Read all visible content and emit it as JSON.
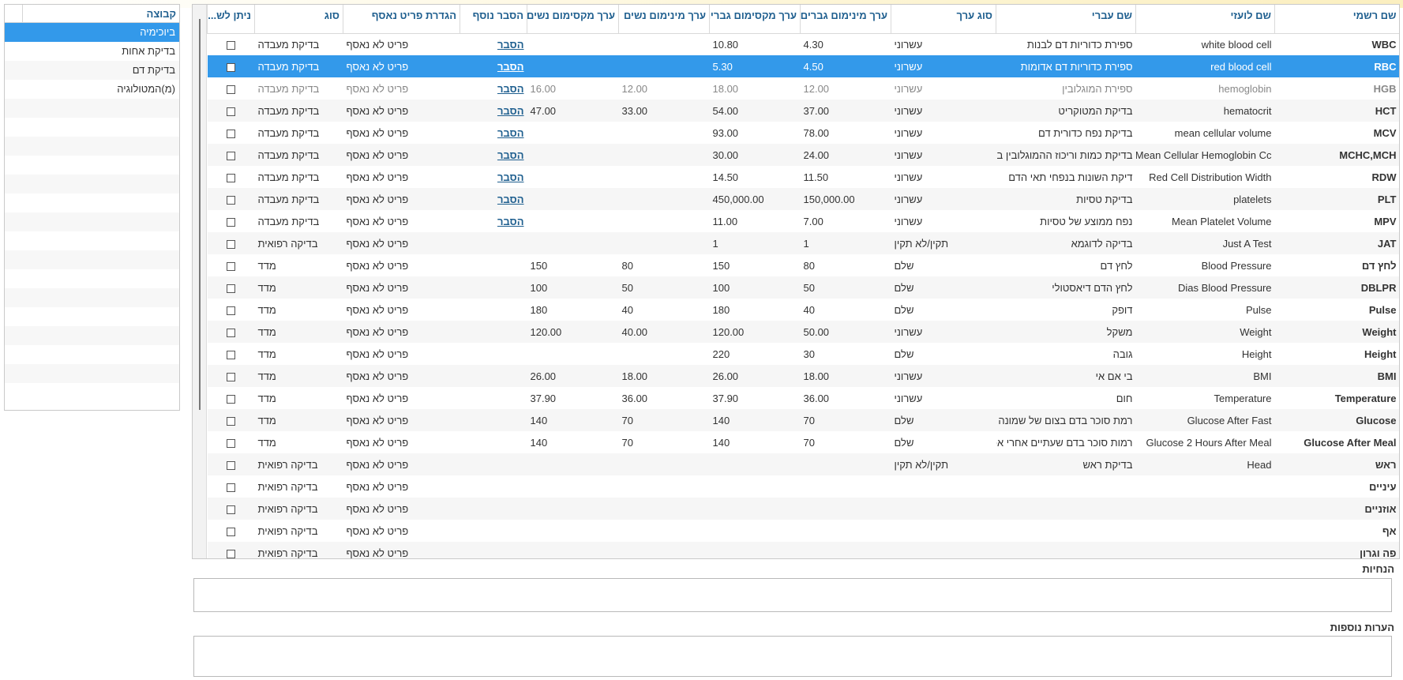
{
  "group_panel": {
    "header": "קבוצה",
    "items": [
      "ביוכימיה",
      "בדיקת אחות",
      "בדיקת דם",
      "(מ)המטולוגיה"
    ],
    "selected_index": 0
  },
  "grid": {
    "columns": [
      "שם רשמי",
      "שם לועזי",
      "שם עברי",
      "סוג ערך",
      "ערך מינימום גברים",
      "ערך מקסימום גברים",
      "ערך מינימום נשים",
      "ערך מקסימום נשים",
      "הסבר נוסף",
      "הגדרת פריט נאסף",
      "סוג",
      "ניתן לש..."
    ],
    "selected_row": 1,
    "rows": [
      {
        "code": "WBC",
        "foreign": "white blood cell",
        "hebrew": "ספירת כדוריות דם לבנות",
        "vtype": "עשרוני",
        "min_m": "4.30",
        "max_m": "10.80",
        "min_f": "",
        "max_f": "",
        "explain": "הסבר",
        "collect": "פריט לא נאסף",
        "kind": "בדיקת מעבדה"
      },
      {
        "code": "RBC",
        "foreign": "red blood cell",
        "hebrew": "ספירת כדוריות דם אדומות",
        "vtype": "עשרוני",
        "min_m": "4.50",
        "max_m": "5.30",
        "min_f": "",
        "max_f": "",
        "explain": "הסבר",
        "collect": "פריט לא נאסף",
        "kind": "בדיקת מעבדה"
      },
      {
        "code": "HGB",
        "foreign": "hemoglobin",
        "hebrew": "ספירת המוגלובין",
        "vtype": "עשרוני",
        "min_m": "12.00",
        "max_m": "18.00",
        "min_f": "12.00",
        "max_f": "16.00",
        "explain": "הסבר",
        "collect": "פריט לא נאסף",
        "kind": "בדיקת מעבדה"
      },
      {
        "code": "HCT",
        "foreign": "hematocrit",
        "hebrew": "בדיקת המטוקריט",
        "vtype": "עשרוני",
        "min_m": "37.00",
        "max_m": "54.00",
        "min_f": "33.00",
        "max_f": "47.00",
        "explain": "הסבר",
        "collect": "פריט לא נאסף",
        "kind": "בדיקת מעבדה"
      },
      {
        "code": "MCV",
        "foreign": "mean cellular volume",
        "hebrew": "בדיקת נפח כדורית דם",
        "vtype": "עשרוני",
        "min_m": "78.00",
        "max_m": "93.00",
        "min_f": "",
        "max_f": "",
        "explain": "הסבר",
        "collect": "פריט לא נאסף",
        "kind": "בדיקת מעבדה"
      },
      {
        "code": "MCHC,MCH",
        "foreign": "Mean Cellular Hemoglobin Cc",
        "hebrew": "בדיקת כמות וריכוז ההמוגלובין בכ:",
        "vtype": "עשרוני",
        "min_m": "24.00",
        "max_m": "30.00",
        "min_f": "",
        "max_f": "",
        "explain": "הסבר",
        "collect": "פריט לא נאסף",
        "kind": "בדיקת מעבדה"
      },
      {
        "code": "RDW",
        "foreign": "Red Cell Distribution Width",
        "hebrew": "דיקת השונות בנפחי תאי הדם",
        "vtype": "עשרוני",
        "min_m": "11.50",
        "max_m": "14.50",
        "min_f": "",
        "max_f": "",
        "explain": "הסבר",
        "collect": "פריט לא נאסף",
        "kind": "בדיקת מעבדה"
      },
      {
        "code": "PLT",
        "foreign": "platelets",
        "hebrew": "בדיקת טסיות",
        "vtype": "עשרוני",
        "min_m": "150,000.00",
        "max_m": "450,000.00",
        "min_f": "",
        "max_f": "",
        "explain": "הסבר",
        "collect": "פריט לא נאסף",
        "kind": "בדיקת מעבדה"
      },
      {
        "code": "MPV",
        "foreign": "Mean Platelet Volume",
        "hebrew": "נפח ממוצע של טסיות",
        "vtype": "עשרוני",
        "min_m": "7.00",
        "max_m": "11.00",
        "min_f": "",
        "max_f": "",
        "explain": "הסבר",
        "collect": "פריט לא נאסף",
        "kind": "בדיקת מעבדה"
      },
      {
        "code": "JAT",
        "foreign": "Just A Test",
        "hebrew": "בדיקה לדוגמא",
        "vtype": "תקין/לא תקין",
        "min_m": "1",
        "max_m": "1",
        "min_f": "",
        "max_f": "",
        "explain": "",
        "collect": "פריט לא נאסף",
        "kind": "בדיקה רפואית"
      },
      {
        "code": "לחץ דם",
        "foreign": "Blood Pressure",
        "hebrew": "לחץ דם",
        "vtype": "שלם",
        "min_m": "80",
        "max_m": "150",
        "min_f": "80",
        "max_f": "150",
        "explain": "",
        "collect": "פריט לא נאסף",
        "kind": "מדד"
      },
      {
        "code": "DBLPR",
        "foreign": "Dias Blood Pressure",
        "hebrew": "לחץ הדם דיאסטולי",
        "vtype": "שלם",
        "min_m": "50",
        "max_m": "100",
        "min_f": "50",
        "max_f": "100",
        "explain": "",
        "collect": "פריט לא נאסף",
        "kind": "מדד"
      },
      {
        "code": "Pulse",
        "foreign": "Pulse",
        "hebrew": "דופק",
        "vtype": "שלם",
        "min_m": "40",
        "max_m": "180",
        "min_f": "40",
        "max_f": "180",
        "explain": "",
        "collect": "פריט לא נאסף",
        "kind": "מדד"
      },
      {
        "code": "Weight",
        "foreign": "Weight",
        "hebrew": "משקל",
        "vtype": "עשרוני",
        "min_m": "50.00",
        "max_m": "120.00",
        "min_f": "40.00",
        "max_f": "120.00",
        "explain": "",
        "collect": "פריט לא נאסף",
        "kind": "מדד"
      },
      {
        "code": "Height",
        "foreign": "Height",
        "hebrew": "גובה",
        "vtype": "שלם",
        "min_m": "30",
        "max_m": "220",
        "min_f": "",
        "max_f": "",
        "explain": "",
        "collect": "פריט לא נאסף",
        "kind": "מדד"
      },
      {
        "code": "BMI",
        "foreign": "BMI",
        "hebrew": "בי אם אי",
        "vtype": "עשרוני",
        "min_m": "18.00",
        "max_m": "26.00",
        "min_f": "18.00",
        "max_f": "26.00",
        "explain": "",
        "collect": "פריט לא נאסף",
        "kind": "מדד"
      },
      {
        "code": "Temperature",
        "foreign": "Temperature",
        "hebrew": "חום",
        "vtype": "עשרוני",
        "min_m": "36.00",
        "max_m": "37.90",
        "min_f": "36.00",
        "max_f": "37.90",
        "explain": "",
        "collect": "פריט לא נאסף",
        "kind": "מדד"
      },
      {
        "code": "Glucose",
        "foreign": "Glucose After Fast",
        "hebrew": "רמת סוכר בדם בצום של שמונה ע",
        "vtype": "שלם",
        "min_m": "70",
        "max_m": "140",
        "min_f": "70",
        "max_f": "140",
        "explain": "",
        "collect": "פריט לא נאסף",
        "kind": "מדד"
      },
      {
        "code": "Glucose After Meal",
        "foreign": "Glucose 2 Hours After Meal",
        "hebrew": "רמות סוכר בדם שעתיים אחרי אכי",
        "vtype": "שלם",
        "min_m": "70",
        "max_m": "140",
        "min_f": "70",
        "max_f": "140",
        "explain": "",
        "collect": "פריט לא נאסף",
        "kind": "מדד"
      },
      {
        "code": "ראש",
        "foreign": "Head",
        "hebrew": "בדיקת ראש",
        "vtype": "תקין/לא תקין",
        "min_m": "",
        "max_m": "",
        "min_f": "",
        "max_f": "",
        "explain": "",
        "collect": "פריט לא נאסף",
        "kind": "בדיקה רפואית"
      },
      {
        "code": "עיניים",
        "foreign": "",
        "hebrew": "",
        "vtype": "",
        "min_m": "",
        "max_m": "",
        "min_f": "",
        "max_f": "",
        "explain": "",
        "collect": "פריט לא נאסף",
        "kind": "בדיקה רפואית"
      },
      {
        "code": "אוזניים",
        "foreign": "",
        "hebrew": "",
        "vtype": "",
        "min_m": "",
        "max_m": "",
        "min_f": "",
        "max_f": "",
        "explain": "",
        "collect": "פריט לא נאסף",
        "kind": "בדיקה רפואית"
      },
      {
        "code": "אף",
        "foreign": "",
        "hebrew": "",
        "vtype": "",
        "min_m": "",
        "max_m": "",
        "min_f": "",
        "max_f": "",
        "explain": "",
        "collect": "פריט לא נאסף",
        "kind": "בדיקה רפואית"
      },
      {
        "code": "פה וגרון",
        "foreign": "",
        "hebrew": "",
        "vtype": "",
        "min_m": "",
        "max_m": "",
        "min_f": "",
        "max_f": "",
        "explain": "",
        "collect": "פריט לא נאסף",
        "kind": "בדיקה רפואית"
      }
    ]
  },
  "instructions": {
    "label": "הנחיות",
    "value": ""
  },
  "notes": {
    "label": "הערות נוספות",
    "value": ""
  }
}
